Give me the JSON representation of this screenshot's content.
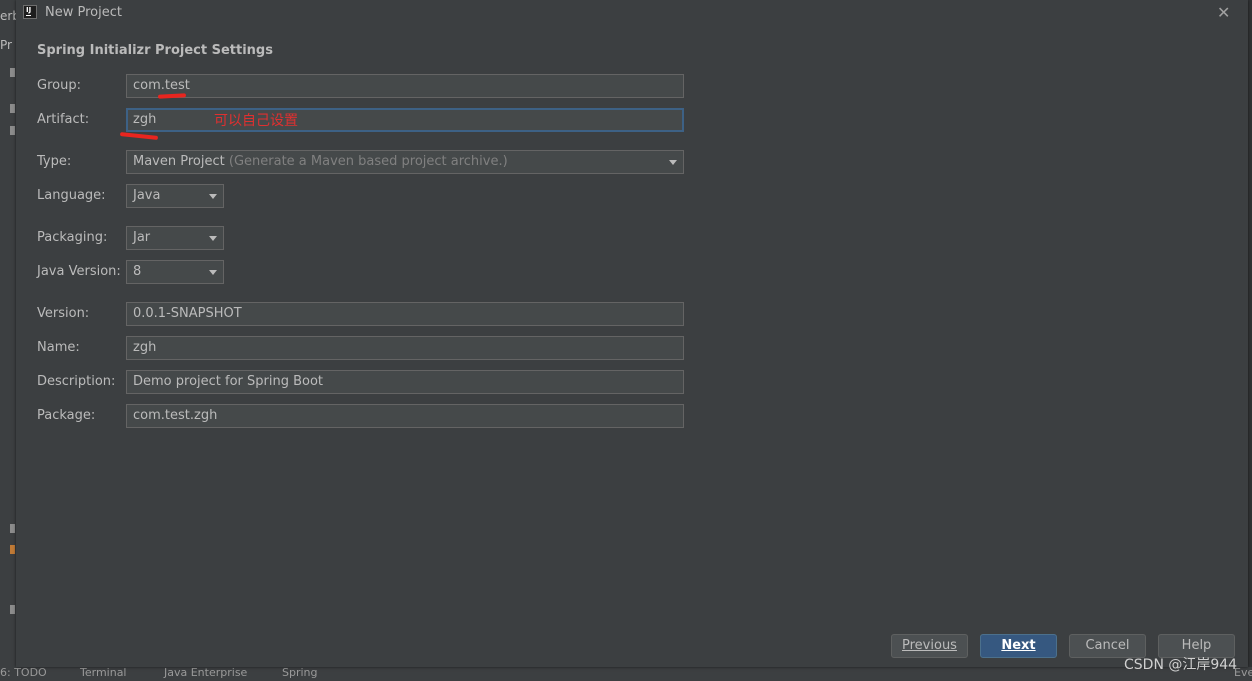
{
  "ide": {
    "left_fragments": [
      "erb",
      "Pr"
    ],
    "bottom_tabs": [
      "6: TODO",
      "Terminal",
      "Java Enterprise",
      "Spring",
      "Eve"
    ]
  },
  "dialog": {
    "title": "New Project",
    "section_title": "Spring Initializr Project Settings",
    "fields": {
      "group": {
        "label": "Group:",
        "value": "com.test"
      },
      "artifact": {
        "label": "Artifact:",
        "value": "zgh"
      },
      "type": {
        "label": "Type:",
        "value": "Maven Project",
        "hint": "(Generate a Maven based project archive.)"
      },
      "language": {
        "label": "Language:",
        "value": "Java"
      },
      "packaging": {
        "label": "Packaging:",
        "value": "Jar"
      },
      "java_version": {
        "label": "Java Version:",
        "value": "8"
      },
      "version": {
        "label": "Version:",
        "value": "0.0.1-SNAPSHOT"
      },
      "name": {
        "label": "Name:",
        "value": "zgh"
      },
      "description": {
        "label": "Description:",
        "value": "Demo project for Spring Boot"
      },
      "package": {
        "label": "Package:",
        "value": "com.test.zgh"
      }
    },
    "annotation": "可以自己设置",
    "buttons": {
      "previous": "Previous",
      "next": "Next",
      "cancel": "Cancel",
      "help": "Help"
    }
  },
  "watermark": "CSDN @江岸944",
  "colors": {
    "accent": "#365880",
    "annotation": "#e03030",
    "background": "#3c3f41"
  }
}
